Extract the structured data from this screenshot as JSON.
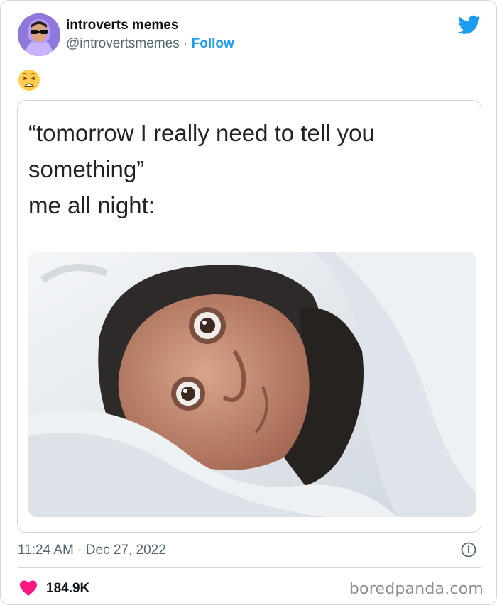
{
  "tweet": {
    "author_name": "introverts memes",
    "author_handle": "@introvertsmemes",
    "separator": "·",
    "follow_label": "Follow",
    "emoji_name": "weary-face-emoji",
    "timestamp": "11:24 AM · Dec 27, 2022",
    "like_count": "184.9K"
  },
  "meme": {
    "lines": [
      "“tomorrow I really need to tell you",
      "something”",
      "me all night:"
    ],
    "photo_icon": "man-awake-in-bed-photo"
  },
  "icons": {
    "brand": "twitter-bird-icon",
    "info": "info-icon",
    "like": "heart-icon"
  },
  "colors": {
    "accent": "#1d9bf0",
    "like": "#f91880",
    "text_secondary": "#536471",
    "border": "#cfd9de"
  },
  "watermark": "boredpanda.com"
}
